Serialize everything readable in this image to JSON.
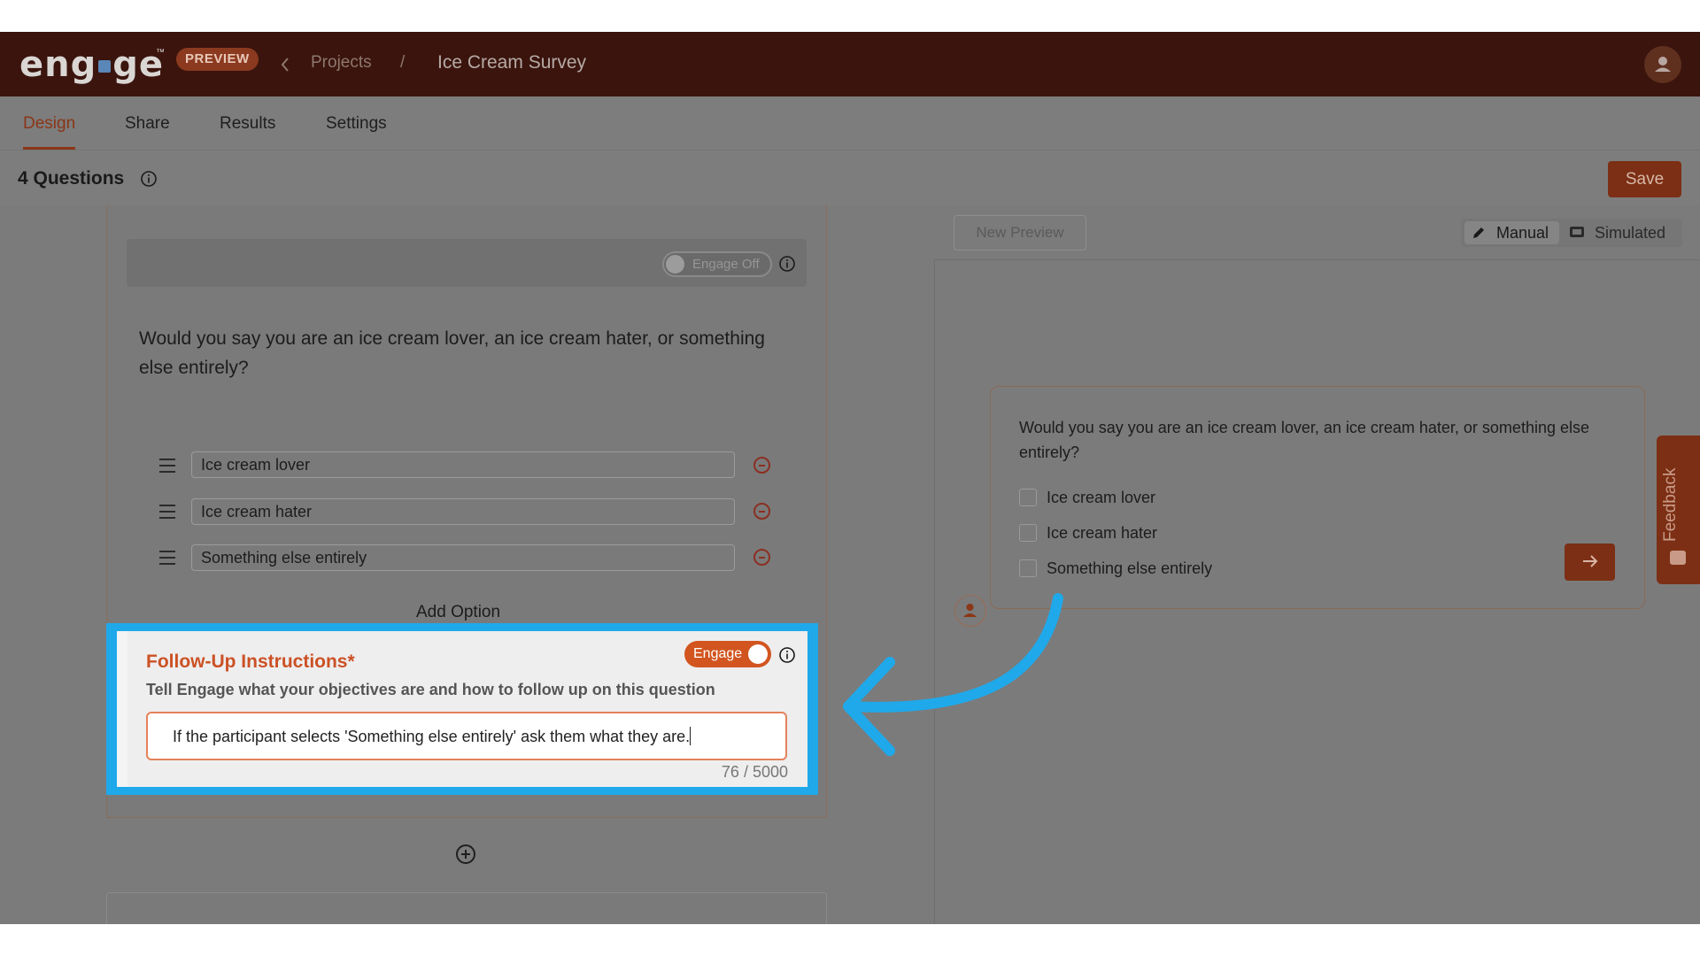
{
  "app": {
    "logo_text": "engage",
    "logo_tm": "™",
    "badge": "PREVIEW"
  },
  "breadcrumb": {
    "projects": "Projects",
    "separator": "/",
    "current": "Ice Cream Survey"
  },
  "tabs": [
    {
      "label": "Design",
      "active": true
    },
    {
      "label": "Share",
      "active": false
    },
    {
      "label": "Results",
      "active": false
    },
    {
      "label": "Settings",
      "active": false
    }
  ],
  "header": {
    "question_count": "4 Questions",
    "save_label": "Save"
  },
  "editor": {
    "engage_off_label": "Engage Off",
    "question": "Would you say you are an ice cream lover, an ice cream hater, or something else entirely?",
    "options": [
      "Ice cream lover",
      "Ice cream hater",
      "Something else entirely"
    ],
    "add_option": "Add Option"
  },
  "follow_up": {
    "title": "Follow-Up Instructions*",
    "subtitle": "Tell Engage what your objectives are and how to follow up on this question",
    "engage_label": "Engage",
    "engage_on": true,
    "value": "If the participant selects 'Something else entirely' ask them what they are.",
    "counter": "76 / 5000"
  },
  "preview": {
    "new_preview": "New Preview",
    "mode_manual": "Manual",
    "mode_simulated": "Simulated",
    "selected_mode": "Manual",
    "question": "Would you say you are an ice cream lover, an ice cream hater, or something else entirely?",
    "options": [
      "Ice cream lover",
      "Ice cream hater",
      "Something else entirely"
    ],
    "feedback": "Feedback"
  },
  "colors": {
    "brand_dark": "#3a140d",
    "accent": "#cc5125",
    "save_button": "#7c2f14",
    "highlight": "#1fa9ea"
  },
  "icons": [
    "chevron-left-icon",
    "info-icon",
    "drag-handle-icon",
    "remove-circle-icon",
    "add-circle-icon",
    "pencil-icon",
    "chat-icon",
    "arrow-right-icon",
    "user-icon",
    "feedback-icon",
    "annotation-arrow"
  ]
}
